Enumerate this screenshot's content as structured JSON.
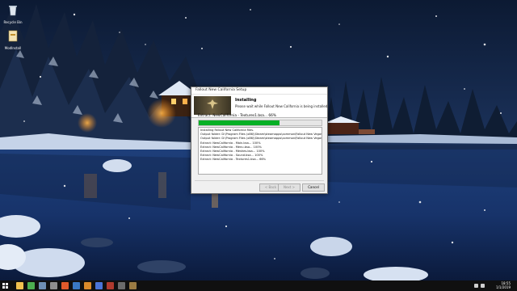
{
  "desktop": {
    "icons": [
      {
        "label": "Recycle Bin"
      },
      {
        "label": "ModInstall"
      }
    ]
  },
  "dialog": {
    "title": "Fallout New California Setup",
    "header_title": "Installing",
    "header_subtitle": "Please wait while Fallout New California is being installed.",
    "status_text": "Extract: NewCalifornia - Textures1.bsa... 66%",
    "progress_percent": 66,
    "log_lines": [
      "Installing Fallout New California files.",
      "Output folder: D:\\Program Files (x86)\\Steam\\steamapps\\common\\Fallout New Vegas",
      "Output folder: D:\\Program Files (x86)\\Steam\\steamapps\\common\\Fallout New Vegas\\...",
      "Extract: NewCalifornia - Main.bsa... 100%",
      "Extract: NewCalifornia - Menu.bsa... 100%",
      "Extract: NewCalifornia - Meshes.bsa... 100%",
      "Extract: NewCalifornia - Sound.bsa... 100%",
      "Extract: NewCalifornia - Textures1.bsa... 66%"
    ],
    "buttons": {
      "back": "< Back",
      "next": "Next >",
      "cancel": "Cancel"
    }
  },
  "taskbar": {
    "pinned": [
      {
        "icon": "folder-icon",
        "color": "#f2c14e"
      },
      {
        "icon": "chrome-icon",
        "color": "#4caf50"
      },
      {
        "icon": "steam-icon",
        "color": "#6e8fb4"
      },
      {
        "icon": "settings-icon",
        "color": "#8e8e8e"
      },
      {
        "icon": "antivirus-icon",
        "color": "#e05a2b"
      },
      {
        "icon": "vortex-icon",
        "color": "#3a78c2"
      },
      {
        "icon": "app-icon",
        "color": "#d98a2a"
      },
      {
        "icon": "app-icon",
        "color": "#4a74d6"
      },
      {
        "icon": "game-icon",
        "color": "#b03a2e"
      },
      {
        "icon": "game-icon",
        "color": "#6b6b6b"
      },
      {
        "icon": "installer-icon",
        "color": "#9a7b43"
      }
    ],
    "time": "18:55",
    "date": "1/1/2019"
  }
}
